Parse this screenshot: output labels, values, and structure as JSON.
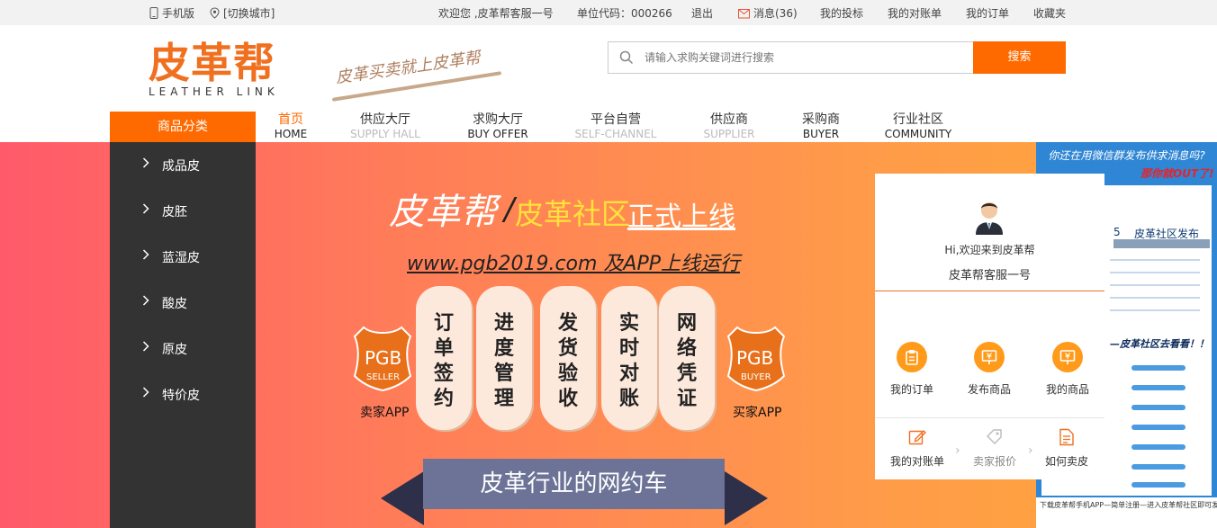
{
  "topbar": {
    "mobile": "手机版",
    "city": "[切换城市]",
    "welcome": "欢迎您 ,皮革帮客服一号",
    "unit_code": "单位代码：000266",
    "logout": "退出",
    "messages": "消息(36)",
    "my_bids": "我的投标",
    "my_statements": "我的对账单",
    "my_orders": "我的订单",
    "favorites": "收藏夹"
  },
  "header": {
    "logo_cn": "皮革帮",
    "logo_en": "LEATHER LINK",
    "slogan": "皮革买卖就上皮革帮",
    "search_placeholder": "请输入求购关键词进行搜索",
    "search_button": "搜索"
  },
  "nav": {
    "category_head": "商品分类",
    "items": [
      {
        "cn": "首页",
        "en": "HOME"
      },
      {
        "cn": "供应大厅",
        "en": "SUPPLY HALL"
      },
      {
        "cn": "求购大厅",
        "en": "BUY OFFER"
      },
      {
        "cn": "平台自营",
        "en": "SELF-CHANNEL"
      },
      {
        "cn": "供应商",
        "en": "SUPPLIER"
      },
      {
        "cn": "采购商",
        "en": "BUYER"
      },
      {
        "cn": "行业社区",
        "en": "COMMUNITY"
      }
    ]
  },
  "sidebar": {
    "items": [
      {
        "label": "成品皮"
      },
      {
        "label": "皮胚"
      },
      {
        "label": "蓝湿皮"
      },
      {
        "label": "酸皮"
      },
      {
        "label": "原皮"
      },
      {
        "label": "特价皮"
      }
    ]
  },
  "banner": {
    "title": "皮革帮",
    "separator": "/",
    "subtitle_a": "皮革社区",
    "subtitle_b": "正式上线",
    "url_line": "www.pgb2019.com 及APP上线运行",
    "seller_badge_top": "PGB",
    "seller_badge_bottom": "SELLER",
    "seller_caption": "卖家APP",
    "buyer_badge_top": "PGB",
    "buyer_badge_bottom": "BUYER",
    "buyer_caption": "买家APP",
    "features": [
      "订单签约",
      "进度管理",
      "发货验收",
      "实时对账",
      "网络凭证"
    ],
    "ribbon": "皮革行业的网约车"
  },
  "user_panel": {
    "welcome": "Hi,欢迎来到皮革帮",
    "username": "皮革帮客服一号",
    "quick": [
      {
        "label": "我的订单",
        "icon": "clipboard-icon"
      },
      {
        "label": "发布商品",
        "icon": "yen-card-icon"
      },
      {
        "label": "我的商品",
        "icon": "yen-card-icon"
      }
    ],
    "steps": [
      {
        "label": "我的对账单",
        "icon": "pen-icon"
      },
      {
        "label": "卖家报价",
        "icon": "tag-icon"
      },
      {
        "label": "如何卖皮",
        "icon": "document-icon"
      }
    ]
  },
  "right_ad": {
    "headline": "你还在用微信群发布供求消息吗?",
    "out": "那你就OUT了!",
    "col_num": "5",
    "col_label": "皮革社区发布",
    "mid": "—皮革社区去看看！！",
    "footer": "下载皮革帮手机APP—简单注册—进入皮革帮社区即可发布查看"
  },
  "colors": {
    "accent": "#ff6a00",
    "sidebar_bg": "#333333"
  }
}
